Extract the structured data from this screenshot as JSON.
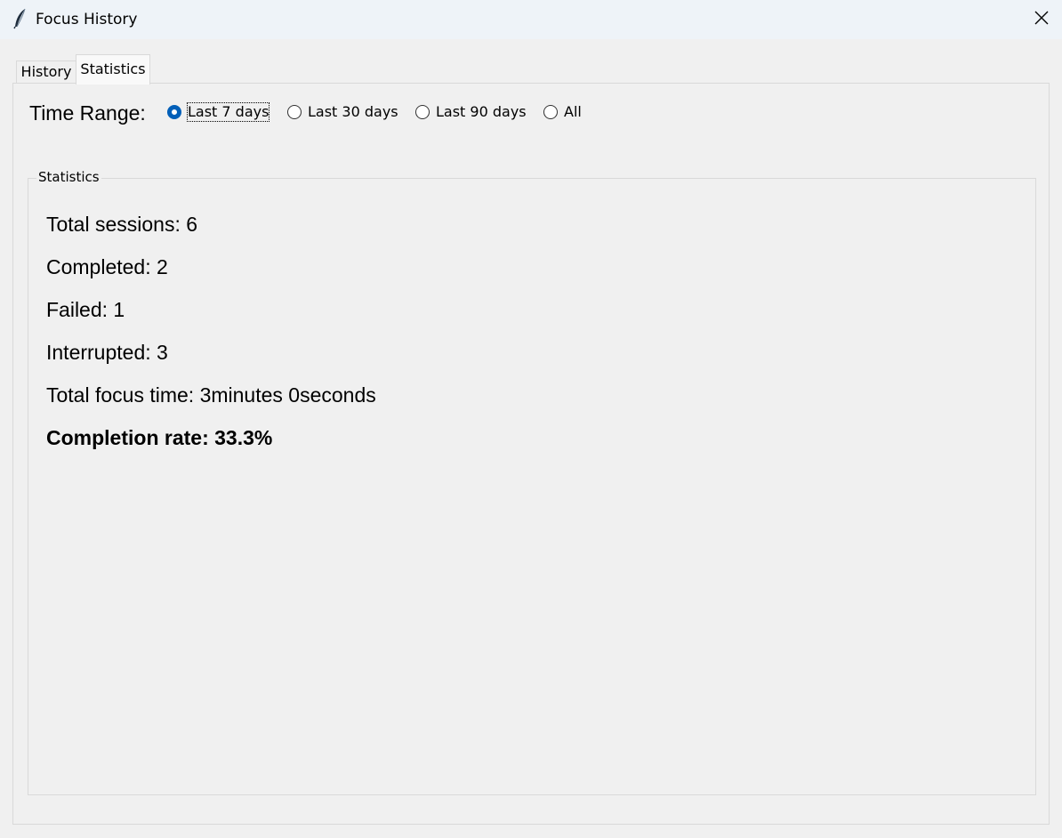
{
  "window": {
    "title": "Focus History",
    "icon": "feather-icon",
    "close_icon": "close-icon"
  },
  "tabs": [
    {
      "label": "History",
      "selected": false
    },
    {
      "label": "Statistics",
      "selected": true
    }
  ],
  "time_range": {
    "label": "Time Range:",
    "options": [
      {
        "label": "Last 7 days",
        "checked": true
      },
      {
        "label": "Last 30 days",
        "checked": false
      },
      {
        "label": "Last 90 days",
        "checked": false
      },
      {
        "label": "All",
        "checked": false
      }
    ],
    "accent_color": "#005fb8"
  },
  "statistics": {
    "group_title": "Statistics",
    "lines": [
      "Total sessions: 6",
      "Completed: 2",
      "Failed: 1",
      "Interrupted: 3",
      "Total focus time: 3minutes 0seconds"
    ],
    "completion_rate": "Completion rate: 33.3%"
  }
}
